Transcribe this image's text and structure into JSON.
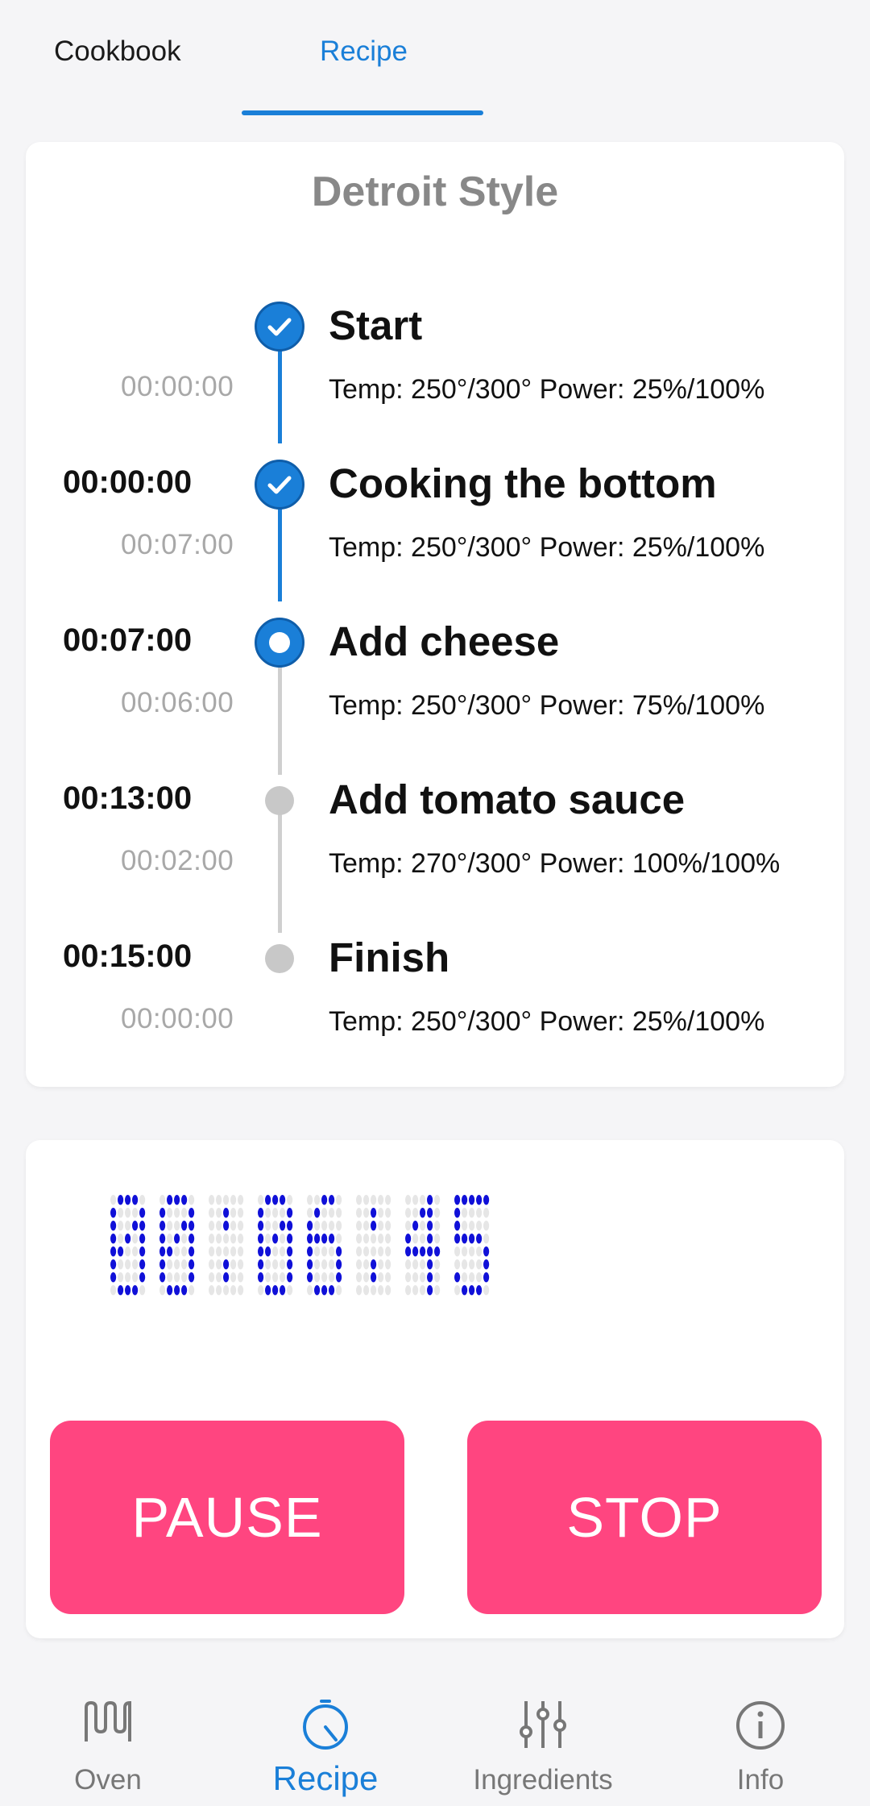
{
  "top_tabs": [
    {
      "label": "Cookbook",
      "active": false
    },
    {
      "label": "Recipe",
      "active": true
    }
  ],
  "recipe": {
    "title": "Detroit Style",
    "steps": [
      {
        "start_time": "",
        "duration": "00:00:00",
        "name": "Start",
        "params": "Temp: 250°/300°  Power: 25%/100%",
        "status": "done"
      },
      {
        "start_time": "00:00:00",
        "duration": "00:07:00",
        "name": "Cooking the bottom",
        "params": "Temp: 250°/300°  Power: 25%/100%",
        "status": "done"
      },
      {
        "start_time": "00:07:00",
        "duration": "00:06:00",
        "name": "Add cheese",
        "params": "Temp: 250°/300°  Power: 75%/100%",
        "status": "current"
      },
      {
        "start_time": "00:13:00",
        "duration": "00:02:00",
        "name": "Add tomato sauce",
        "params": "Temp: 270°/300°  Power: 100%/100%",
        "status": "pending"
      },
      {
        "start_time": "00:15:00",
        "duration": "00:00:00",
        "name": "Finish",
        "params": "Temp: 250°/300°  Power: 25%/100%",
        "status": "pending"
      }
    ]
  },
  "timer": {
    "display": "00:06:45",
    "pause_label": "PAUSE",
    "stop_label": "STOP"
  },
  "bottom_nav": [
    {
      "label": "Oven",
      "icon": "oven-heating-icon",
      "active": false
    },
    {
      "label": "Recipe",
      "icon": "timer-icon",
      "active": true
    },
    {
      "label": "Ingredients",
      "icon": "sliders-icon",
      "active": false
    },
    {
      "label": "Info",
      "icon": "info-icon",
      "active": false
    }
  ],
  "colors": {
    "accent": "#1a7fd8",
    "button": "#ff4580",
    "led_on": "#1010d8",
    "led_off": "#e6e6e6"
  }
}
